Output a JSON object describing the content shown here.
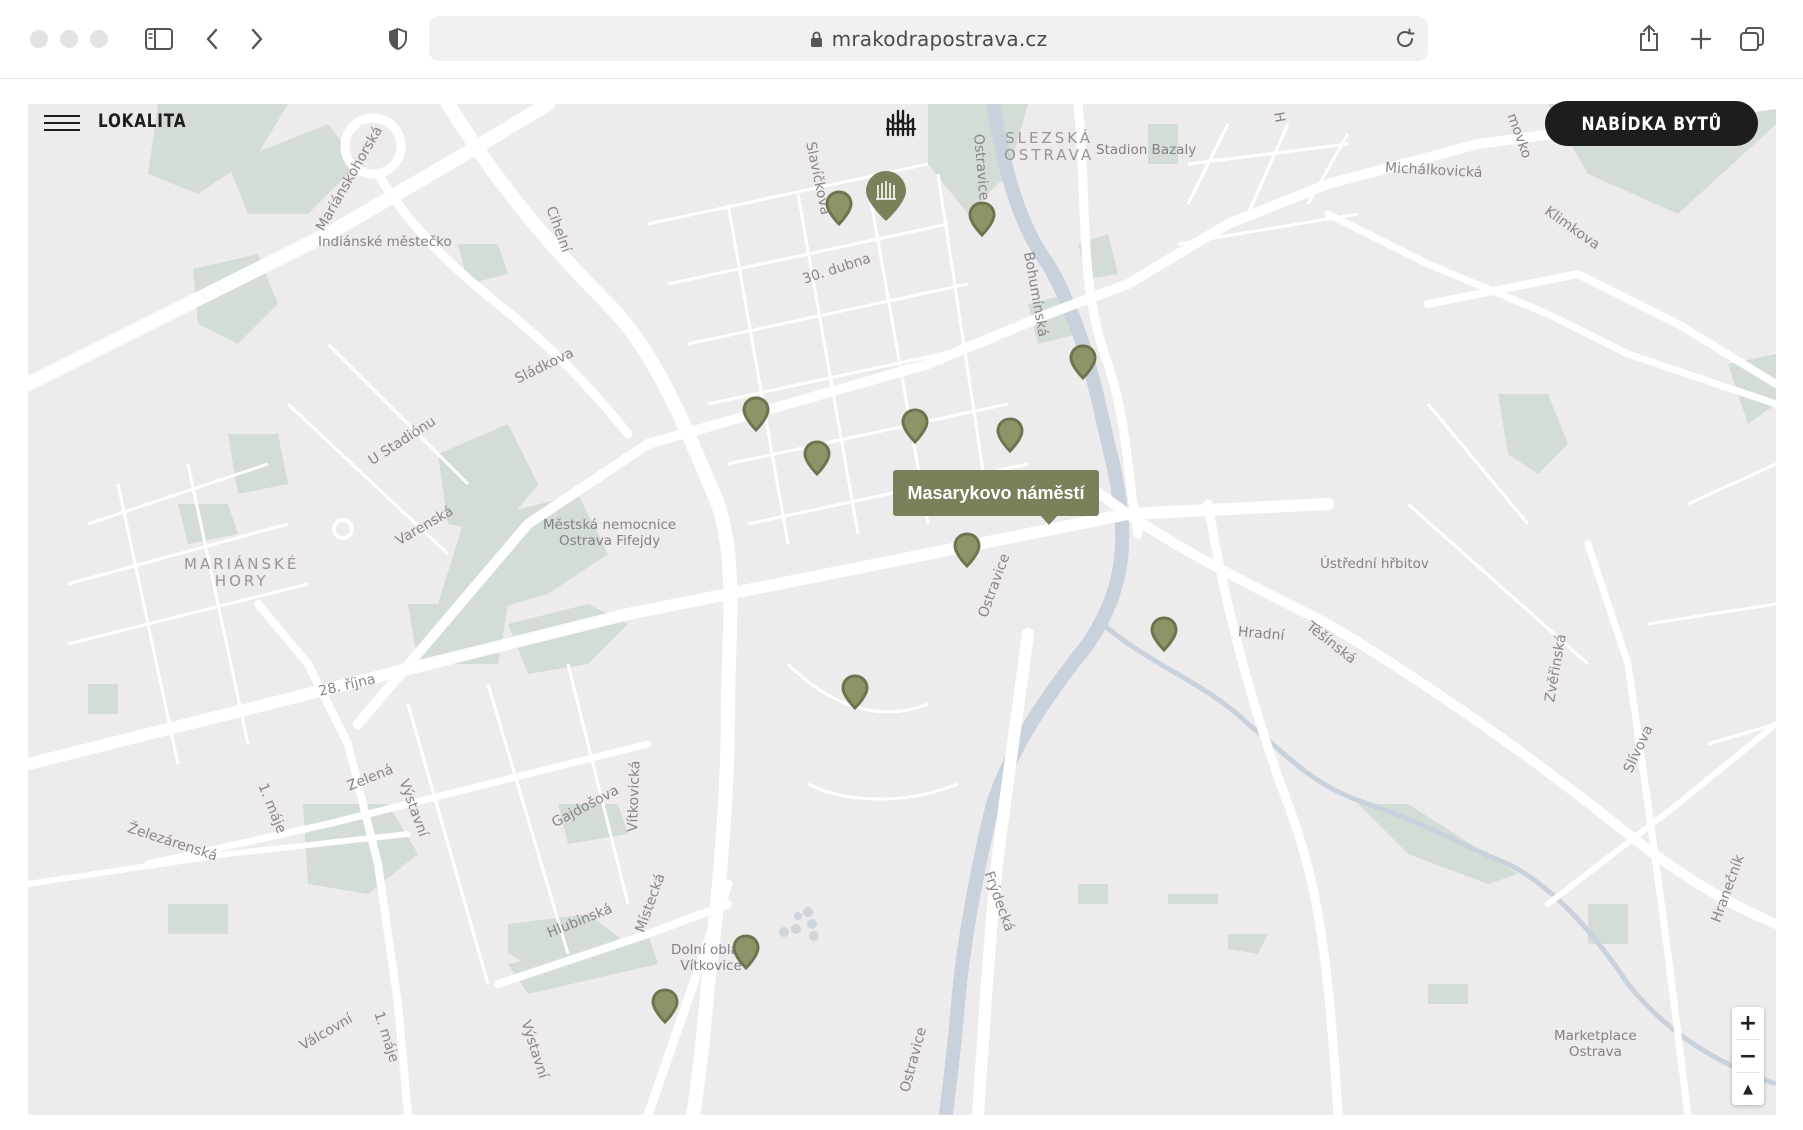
{
  "browser": {
    "url": "mrakodrapostrava.cz"
  },
  "header": {
    "menu_label": "LOKALITA",
    "cta_label": "NABÍDKA BYTŮ"
  },
  "map": {
    "tooltip": "Masarykovo náměstí",
    "marker_color": "#8f9468",
    "marker_outline": "#6f7350",
    "main_marker_color": "#7b7f5a",
    "street_labels": {
      "marianskohorska": "Mariánskohorská",
      "cihelni": "Cihelní",
      "slavickova": "Slavíčkova",
      "ostravice_top": "Ostravice",
      "ostravice_mid": "Ostravice",
      "ostravice_bottom": "Ostravice",
      "dubna": "30. dubna",
      "bohuminska": "Bohumínská",
      "michalkovicka": "Michálkovická",
      "klimkova": "Klimkova",
      "hlucinska": "H",
      "kounicova": "movko",
      "sladkova": "Sládkova",
      "u_stadionu": "U Stadiónu",
      "varenska": "Varenská",
      "rijna": "28. října",
      "zelena": "Zelená",
      "vystavni1": "Výstavní",
      "vystavni2": "Výstavní",
      "maje1": "1. máje",
      "maje2": "1. máje",
      "zelezarenska": "Železárenská",
      "gajdosova": "Gajdošova",
      "vitkovicka": "Vítkovická",
      "mistecka": "Místecká",
      "hlubinska": "Hlubinská",
      "valcovni": "Válcovní",
      "frydecka": "Frýdecká",
      "hradni": "Hradní",
      "tesinska": "Těšínská",
      "zverinska": "Zvěřinská",
      "slivova": "Slívova",
      "hranecnik": "Hranečník"
    },
    "district_labels": {
      "slezska": "SLEZSKÁ\nOSTRAVA",
      "marianske": "MARIÁNSKÉ\nHORY"
    },
    "poi_labels": {
      "stadion": "Stadion Bazaly",
      "indianske": "Indiánské městečko",
      "nemocnice": "Městská nemocnice\nOstrava Fifejdy",
      "hrbitov": "Ústřední hřbitov",
      "dolni": "Dolní oblast\nVítkovice",
      "marketplace": "Marketplace\nOstrava"
    }
  },
  "zoom": {
    "plus": "+",
    "minus": "−",
    "compass": "▲"
  }
}
